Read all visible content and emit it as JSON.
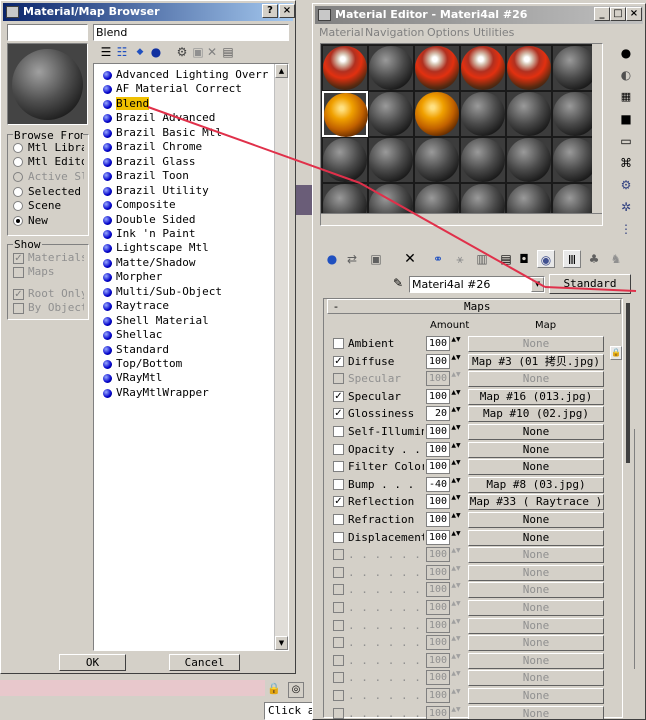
{
  "browser": {
    "title": "Material/Map Browser",
    "help_btn": "?",
    "close_btn": "×",
    "search_value": "Blend",
    "browse_from_label": "Browse From:",
    "browse_options": [
      {
        "label": "Mtl Library",
        "selected": false,
        "enabled": true
      },
      {
        "label": "Mtl Editor",
        "selected": false,
        "enabled": true
      },
      {
        "label": "Active Slot",
        "selected": false,
        "enabled": false
      },
      {
        "label": "Selected",
        "selected": false,
        "enabled": true
      },
      {
        "label": "Scene",
        "selected": false,
        "enabled": true
      },
      {
        "label": "New",
        "selected": true,
        "enabled": true
      }
    ],
    "show_label": "Show",
    "show_options": [
      {
        "label": "Materials",
        "checked": true
      },
      {
        "label": "Maps",
        "checked": false
      }
    ],
    "root_options": [
      {
        "label": "Root Only",
        "checked": true
      },
      {
        "label": "By Object",
        "checked": false
      }
    ],
    "items": [
      "Advanced Lighting Override",
      "AF Material Correct",
      "Blend",
      "Brazil Advanced",
      "Brazil Basic Mtl",
      "Brazil Chrome",
      "Brazil Glass",
      "Brazil Toon",
      "Brazil Utility",
      "Composite",
      "Double Sided",
      "Ink 'n Paint",
      "Lightscape Mtl",
      "Matte/Shadow",
      "Morpher",
      "Multi/Sub-Object",
      "Raytrace",
      "Shell Material",
      "Shellac",
      "Standard",
      "Top/Bottom",
      "VRayMtl",
      "VRayMtlWrapper"
    ],
    "selected_item": "Blend",
    "ok": "OK",
    "cancel": "Cancel"
  },
  "editor": {
    "title": "Material Editor - Materi4al #26",
    "menu": [
      "Material",
      "Navigation",
      "Options",
      "Utilities"
    ],
    "material_name": "Materi4al #26",
    "material_type": "Standard",
    "rollout_title": "Maps",
    "rollout_toggle": "-",
    "col_amount": "Amount",
    "col_map": "Map",
    "maps": [
      {
        "label": "Ambient",
        "checked": false,
        "enabled": true,
        "amount": "100",
        "map": "None",
        "map_enabled": false
      },
      {
        "label": "Diffuse",
        "checked": true,
        "enabled": true,
        "amount": "100",
        "map": "Map #3 (01 拷贝.jpg)",
        "map_enabled": true
      },
      {
        "label": "Specular",
        "checked": false,
        "enabled": false,
        "amount": "100",
        "map": "None",
        "map_enabled": false
      },
      {
        "label": "Specular",
        "checked": true,
        "enabled": true,
        "amount": "100",
        "map": "Map #16 (013.jpg)",
        "map_enabled": true
      },
      {
        "label": "Glossiness",
        "checked": true,
        "enabled": true,
        "amount": "20",
        "map": "Map #10 (02.jpg)",
        "map_enabled": true
      },
      {
        "label": "Self-Illumin",
        "checked": false,
        "enabled": true,
        "amount": "100",
        "map": "None",
        "map_enabled": true
      },
      {
        "label": "Opacity . .",
        "checked": false,
        "enabled": true,
        "amount": "100",
        "map": "None",
        "map_enabled": true
      },
      {
        "label": "Filter Color",
        "checked": false,
        "enabled": true,
        "amount": "100",
        "map": "None",
        "map_enabled": true
      },
      {
        "label": "Bump  . . .",
        "checked": false,
        "enabled": true,
        "amount": "-40",
        "map": "Map #8 (03.jpg)",
        "map_enabled": true
      },
      {
        "label": "Reflection",
        "checked": true,
        "enabled": true,
        "amount": "100",
        "map": "Map #33  ( Raytrace )",
        "map_enabled": true
      },
      {
        "label": "Refraction",
        "checked": false,
        "enabled": true,
        "amount": "100",
        "map": "None",
        "map_enabled": true
      },
      {
        "label": "Displacement",
        "checked": false,
        "enabled": true,
        "amount": "100",
        "map": "None",
        "map_enabled": true
      },
      {
        "label": ". . . . . . .",
        "checked": false,
        "enabled": false,
        "amount": "100",
        "map": "None",
        "map_enabled": false
      },
      {
        "label": ". . . . . . .",
        "checked": false,
        "enabled": false,
        "amount": "100",
        "map": "None",
        "map_enabled": false
      },
      {
        "label": ". . . . . . .",
        "checked": false,
        "enabled": false,
        "amount": "100",
        "map": "None",
        "map_enabled": false
      },
      {
        "label": ". . . . . . .",
        "checked": false,
        "enabled": false,
        "amount": "100",
        "map": "None",
        "map_enabled": false
      },
      {
        "label": ". . . . . . .",
        "checked": false,
        "enabled": false,
        "amount": "100",
        "map": "None",
        "map_enabled": false
      },
      {
        "label": ". . . . . . .",
        "checked": false,
        "enabled": false,
        "amount": "100",
        "map": "None",
        "map_enabled": false
      },
      {
        "label": ". . . . . . .",
        "checked": false,
        "enabled": false,
        "amount": "100",
        "map": "None",
        "map_enabled": false
      },
      {
        "label": ". . . . . . .",
        "checked": false,
        "enabled": false,
        "amount": "100",
        "map": "None",
        "map_enabled": false
      },
      {
        "label": ". . . . . . .",
        "checked": false,
        "enabled": false,
        "amount": "100",
        "map": "None",
        "map_enabled": false
      },
      {
        "label": ". . . . . . .",
        "checked": false,
        "enabled": false,
        "amount": "100",
        "map": "None",
        "map_enabled": false
      }
    ],
    "slots": [
      "red",
      "gray",
      "red",
      "red",
      "red",
      "gray",
      "gold",
      "gray",
      "gold",
      "gray",
      "gray",
      "gray",
      "gray",
      "gray",
      "gray",
      "gray",
      "gray",
      "gray",
      "gray",
      "gray",
      "gray",
      "gray",
      "gray",
      "gray"
    ]
  },
  "status": {
    "prompt": "Click a"
  },
  "colors": {
    "annotation_line": "#e0304a",
    "title_active": "#0a246a",
    "select_highlight": "#f0c000"
  }
}
